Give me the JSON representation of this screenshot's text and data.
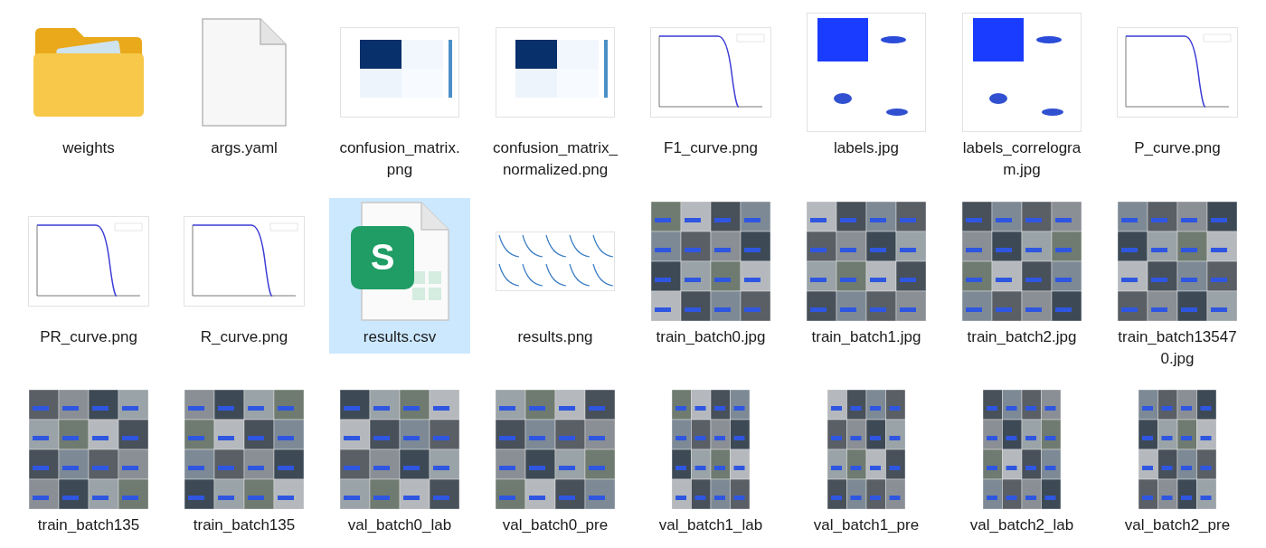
{
  "files": [
    {
      "name": "weights",
      "kind": "folder",
      "selected": false
    },
    {
      "name": "args.yaml",
      "kind": "document",
      "selected": false
    },
    {
      "name": "confusion_matrix.png",
      "kind": "matrix",
      "selected": false
    },
    {
      "name": "confusion_matrix_normalized.png",
      "kind": "matrix",
      "selected": false
    },
    {
      "name": "F1_curve.png",
      "kind": "curve",
      "selected": false
    },
    {
      "name": "labels.jpg",
      "kind": "scatter",
      "selected": false
    },
    {
      "name": "labels_correlogram.jpg",
      "kind": "scatter",
      "selected": false
    },
    {
      "name": "P_curve.png",
      "kind": "curve",
      "selected": false
    },
    {
      "name": "PR_curve.png",
      "kind": "curve",
      "selected": false
    },
    {
      "name": "R_curve.png",
      "kind": "curve",
      "selected": false
    },
    {
      "name": "results.csv",
      "kind": "spreadsheet",
      "badge": "S",
      "selected": true
    },
    {
      "name": "results.png",
      "kind": "plots",
      "selected": false
    },
    {
      "name": "train_batch0.jpg",
      "kind": "photo",
      "selected": false
    },
    {
      "name": "train_batch1.jpg",
      "kind": "photo",
      "selected": false
    },
    {
      "name": "train_batch2.jpg",
      "kind": "photo",
      "selected": false
    },
    {
      "name": "train_batch135470.jpg",
      "kind": "photo",
      "selected": false
    },
    {
      "name": "train_batch135",
      "kind": "photo",
      "selected": false
    },
    {
      "name": "train_batch135",
      "kind": "photo",
      "selected": false
    },
    {
      "name": "val_batch0_lab",
      "kind": "photo",
      "selected": false
    },
    {
      "name": "val_batch0_pre",
      "kind": "photo",
      "selected": false
    },
    {
      "name": "val_batch1_lab",
      "kind": "photo_tall",
      "selected": false
    },
    {
      "name": "val_batch1_pre",
      "kind": "photo_tall",
      "selected": false
    },
    {
      "name": "val_batch2_lab",
      "kind": "photo_tall",
      "selected": false
    },
    {
      "name": "val_batch2_pre",
      "kind": "photo_tall",
      "selected": false
    }
  ]
}
